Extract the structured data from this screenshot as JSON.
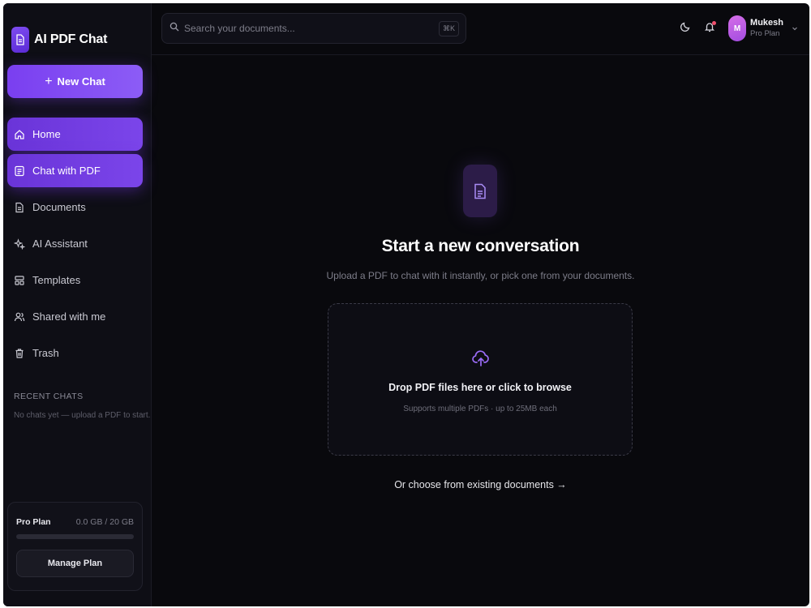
{
  "brand": {
    "title": "AI PDF Chat",
    "icon": "document-icon"
  },
  "sidebar": {
    "new_chat_label": "New Chat",
    "items": [
      {
        "label": "Home",
        "icon": "home-icon",
        "active": true
      },
      {
        "label": "Chat with PDF",
        "icon": "chat-document-icon",
        "active": true
      },
      {
        "label": "Documents",
        "icon": "document-icon",
        "active": false
      },
      {
        "label": "AI Assistant",
        "icon": "sparkles-icon",
        "active": false
      },
      {
        "label": "Templates",
        "icon": "layout-icon",
        "active": false
      },
      {
        "label": "Shared with me",
        "icon": "users-icon",
        "active": false
      },
      {
        "label": "Trash",
        "icon": "trash-icon",
        "active": false
      }
    ],
    "recent_title": "RECENT CHATS",
    "recent_empty": "No chats yet — upload a PDF to start.",
    "plan": {
      "name": "Pro Plan",
      "usage": "0.0 GB / 20 GB",
      "usage_fraction": 0.0,
      "manage_label": "Manage Plan"
    }
  },
  "topbar": {
    "search_placeholder": "Search your documents...",
    "shortcut": "⌘K",
    "user": {
      "initial": "M",
      "name": "Mukesh",
      "plan": "Pro Plan"
    }
  },
  "main": {
    "title": "Start a new conversation",
    "subtitle": "Upload a PDF to chat with it instantly, or pick one from your documents.",
    "dropzone": {
      "title": "Drop PDF files here or click to browse",
      "subtitle": "Supports multiple PDFs · up to 25MB each"
    },
    "choose_link": "Or choose from existing documents →"
  },
  "colors": {
    "accent": "#7a3ff0",
    "background": "#09090d",
    "sidebar_bg": "#0e0e15",
    "notification_dot": "#f0506e"
  }
}
